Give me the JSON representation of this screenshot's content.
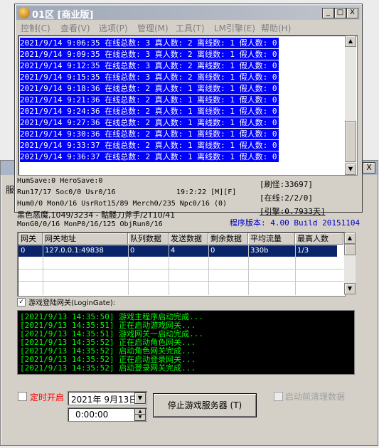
{
  "window": {
    "title": "01区 [商业版]",
    "min_label": "_",
    "max_label": "□",
    "close_label": "X"
  },
  "back_window": {
    "close_label": "X",
    "tab_stub": "服"
  },
  "menu": [
    "控制(C)",
    "查看(V)",
    "选项(P)",
    "管理(M)",
    "工具(T)",
    "LM引擎(E)",
    "帮助(H)"
  ],
  "log_rows": [
    "2021/9/14 9:06:35 在线总数: 3 真人数: 2 离线数: 1 假人数: 0",
    "2021/9/14 9:09:35 在线总数: 3 真人数: 2 离线数: 1 假人数: 0",
    "2021/9/14 9:12:35 在线总数: 3 真人数: 2 离线数: 1 假人数: 0",
    "2021/9/14 9:15:35 在线总数: 3 真人数: 2 离线数: 1 假人数: 0",
    "2021/9/14 9:18:36 在线总数: 2 真人数: 1 离线数: 1 假人数: 0",
    "2021/9/14 9:21:36 在线总数: 2 真人数: 1 离线数: 1 假人数: 0",
    "2021/9/14 9:24:36 在线总数: 2 真人数: 1 离线数: 1 假人数: 0",
    "2021/9/14 9:27:36 在线总数: 2 真人数: 1 离线数: 1 假人数: 0",
    "2021/9/14 9:30:36 在线总数: 2 真人数: 1 离线数: 1 假人数: 0",
    "2021/9/14 9:33:37 在线总数: 2 真人数: 1 离线数: 1 假人数: 0",
    "2021/9/14 9:36:37 在线总数: 2 真人数: 1 离线数: 1 假人数: 0"
  ],
  "info": {
    "humsave": "HumSave:0 HeroSave:0",
    "run": "Run17/17 Soc0/0 Usr0/16",
    "clock": "19:2:22 [M][F]",
    "hum": "Hum0/0 Mon0/16 UsrRot15/89 Merch0/235 Npc0/16 (0)",
    "monster": "黑色恶魔,1049/3234 - 骷髅刀斧手/2T10/41",
    "mon": "MonG0/0/16 MonP0/16/125 ObjRun0/16",
    "shuaguai": "[刷怪:33697]",
    "zaixian": "[在线:2/2/0]",
    "yinqing": "[引擎:0.7933天]",
    "version": "程序版本: 4.00 Build 20151104"
  },
  "gateway_table": {
    "headers": [
      "网关",
      "网关地址",
      "队列数据",
      "发送数据",
      "剩余数据",
      "平均流量",
      "最高人数"
    ],
    "rows": [
      [
        "0",
        "127.0.0.1:49838",
        "0",
        "4",
        "0",
        "330b",
        "1/3"
      ]
    ]
  },
  "login_gate": {
    "checked": true,
    "check_mark": "✓",
    "label": "游戏登陆网关(LoginGate):"
  },
  "console_lines": [
    "[2021/9/13 14:35:50] 游戏主程序启动完成...",
    "[2021/9/13 14:35:51] 正在启动游戏网关...",
    "[2021/9/13 14:35:51] 游戏网关一启动完成...",
    "[2021/9/13 14:35:52] 正在启动角色网关...",
    "[2021/9/13 14:35:52] 启动角色网关完成...",
    "[2021/9/13 14:35:52] 正在启动登录网关...",
    "[2021/9/13 14:35:52] 启动登录网关完成..."
  ],
  "controls": {
    "timer_label": "定时开启",
    "timer_checked": false,
    "date_value": "2021年 9月13日",
    "time_value": "0:00:00",
    "stop_button": "停止游戏服务器 (T)",
    "clean_label": "启动前清理数据",
    "clean_checked": false
  },
  "colors": {
    "log_highlight": "#0000ff",
    "console_text": "#00ff00",
    "console_bg": "#000000",
    "version_text": "#0000cc",
    "timer_label": "#ff0000",
    "selected_row": "#0a246a"
  }
}
